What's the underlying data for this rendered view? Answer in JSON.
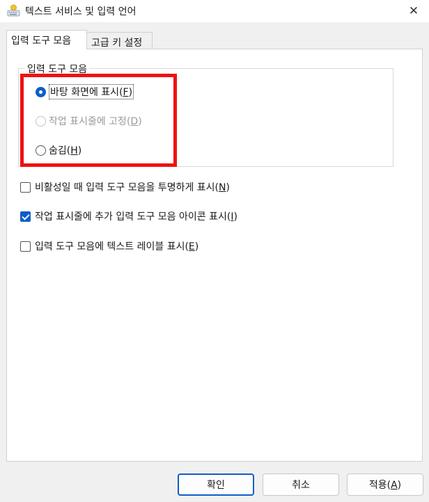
{
  "window": {
    "title": "텍스트 서비스 및 입력 언어",
    "close_glyph": "✕"
  },
  "tabs": [
    {
      "label": "입력 도구 모음",
      "active": true
    },
    {
      "label": "고급 키 설정",
      "active": false
    }
  ],
  "language_bar": {
    "group_title": "입력 도구 모음",
    "options": [
      {
        "label": "바탕 화면에 표시",
        "hotkey": "F",
        "selected": true,
        "disabled": false
      },
      {
        "label": "작업 표시줄에 고정",
        "hotkey": "D",
        "selected": false,
        "disabled": true
      },
      {
        "label": "숨김",
        "hotkey": "H",
        "selected": false,
        "disabled": false
      }
    ]
  },
  "checkboxes": [
    {
      "label": "비활성일 때 입력 도구 모음을 투명하게 표시",
      "hotkey": "N",
      "checked": false
    },
    {
      "label": "작업 표시줄에 추가 입력 도구 모음 아이콘 표시",
      "hotkey": "I",
      "checked": true
    },
    {
      "label": "입력 도구 모음에 텍스트 레이블 표시",
      "hotkey": "E",
      "checked": false
    }
  ],
  "buttons": {
    "ok": "확인",
    "cancel": "취소",
    "apply_label": "적용",
    "apply_hotkey": "A"
  },
  "colors": {
    "accent": "#0f5ec7",
    "highlight_border": "#ee1111"
  }
}
